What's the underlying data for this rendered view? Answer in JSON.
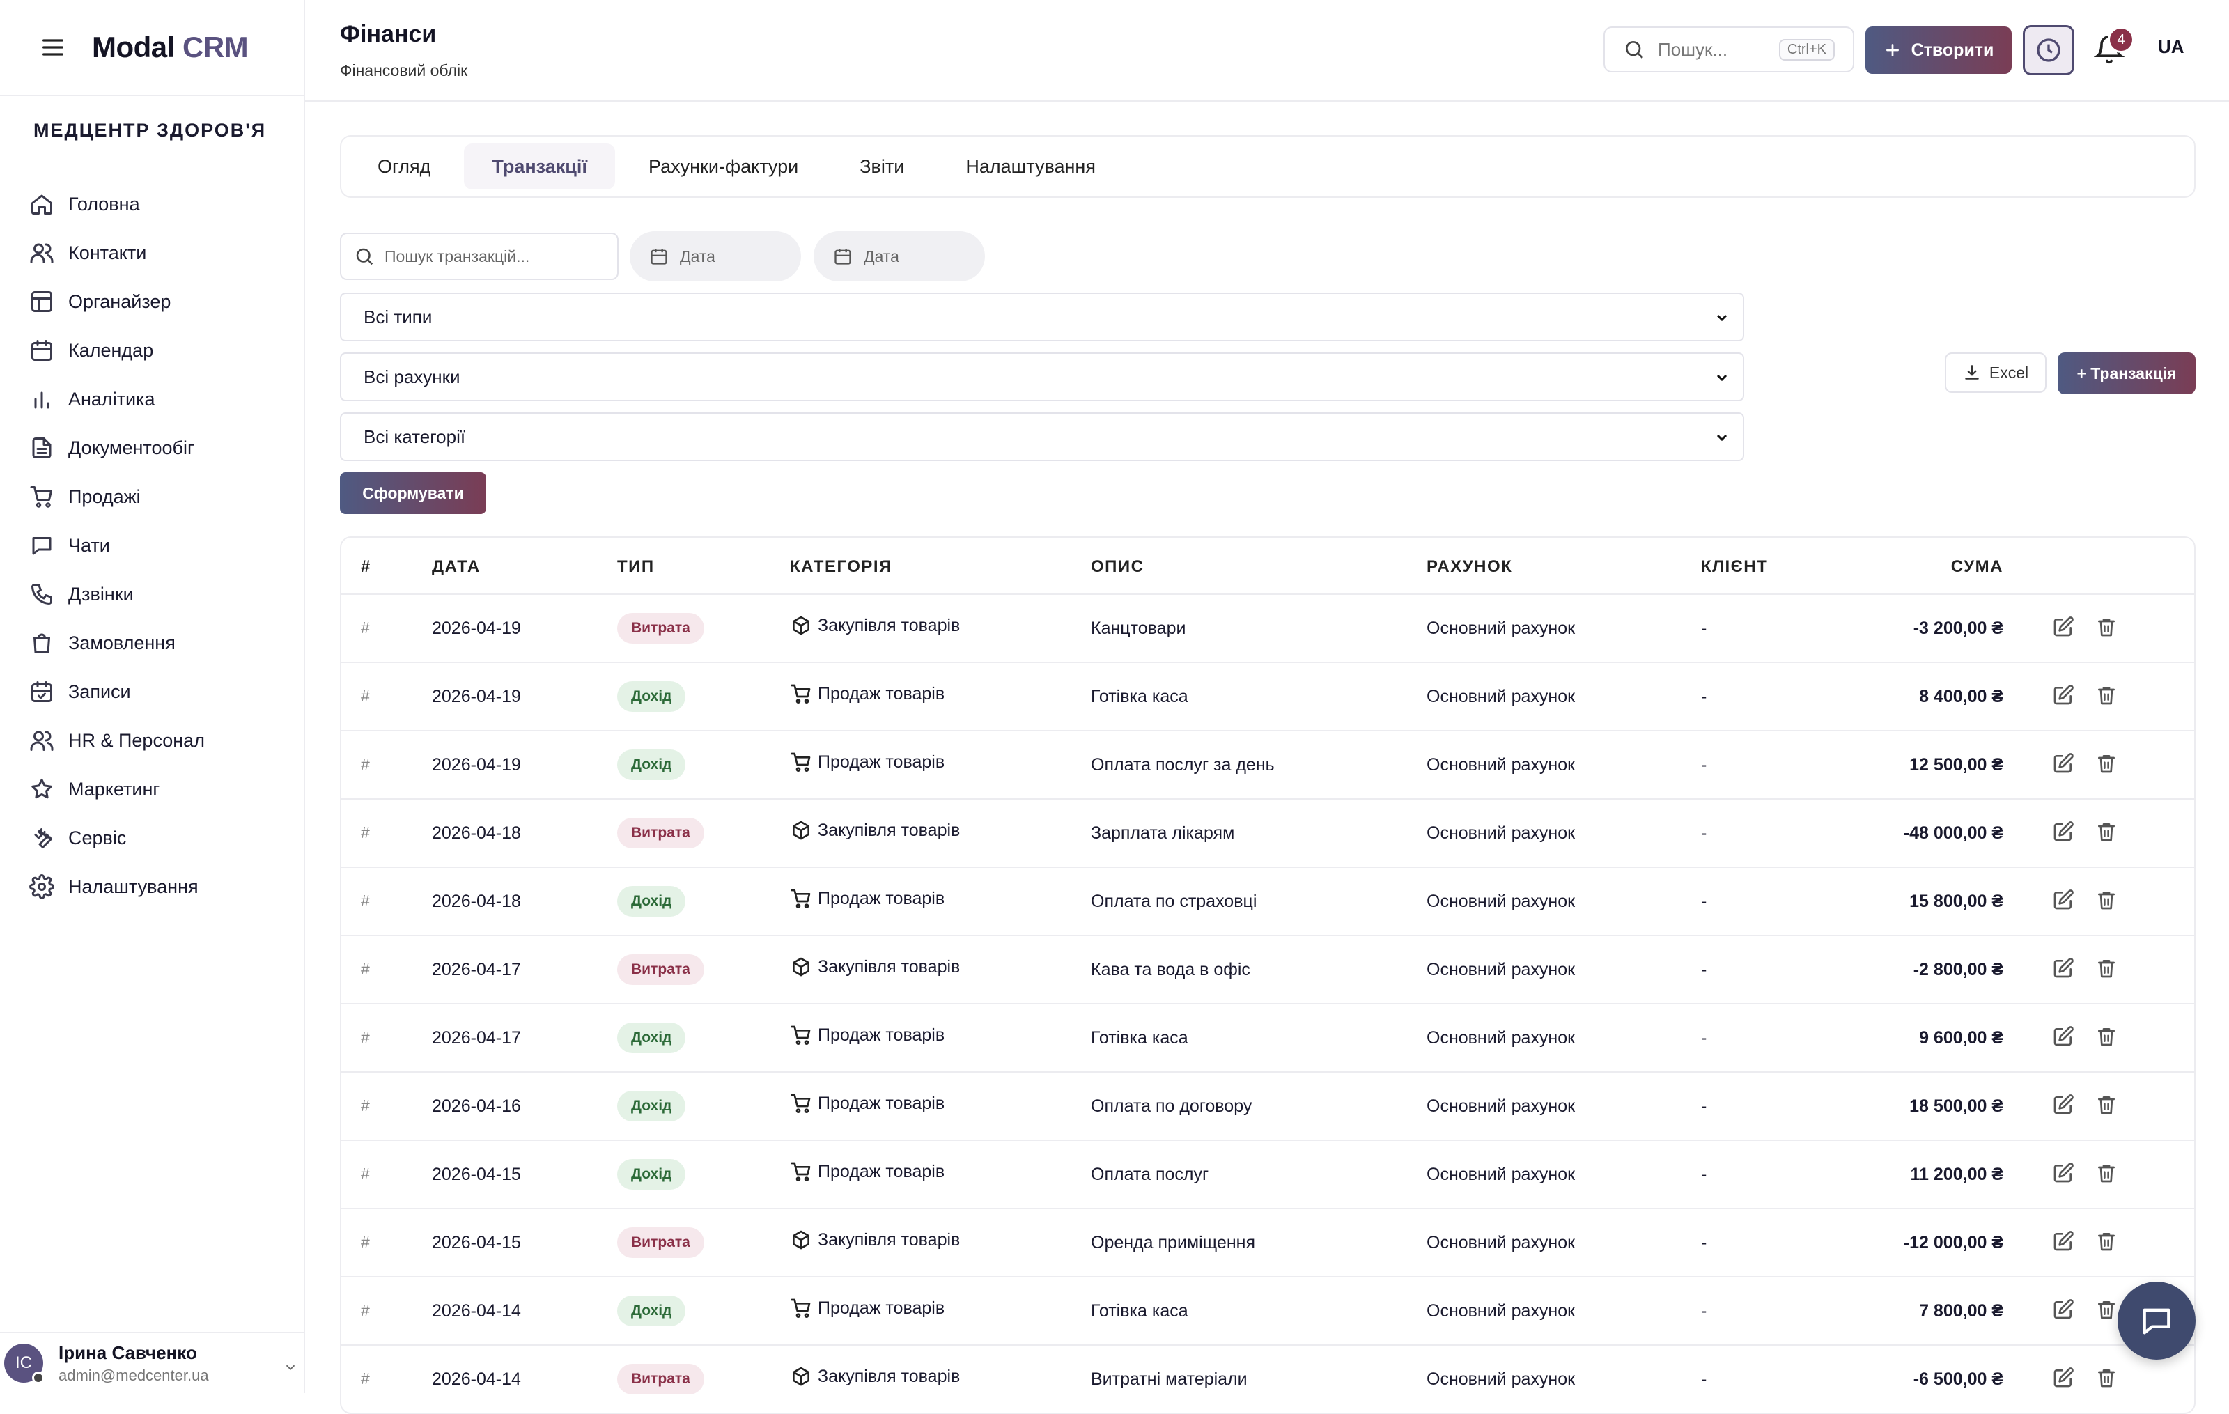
{
  "app": {
    "logo_main": "Modal",
    "logo_accent": "CRM"
  },
  "sidebar": {
    "org_name": "МЕДЦЕНТР ЗДОРОВ'Я",
    "items": [
      {
        "label": "Головна",
        "icon": "home-icon"
      },
      {
        "label": "Контакти",
        "icon": "users-icon"
      },
      {
        "label": "Органайзер",
        "icon": "layout-icon"
      },
      {
        "label": "Календар",
        "icon": "calendar-icon"
      },
      {
        "label": "Аналітика",
        "icon": "bar-chart-icon"
      },
      {
        "label": "Документообіг",
        "icon": "document-icon"
      },
      {
        "label": "Продажі",
        "icon": "cart-icon"
      },
      {
        "label": "Чати",
        "icon": "chat-icon"
      },
      {
        "label": "Дзвінки",
        "icon": "phone-icon"
      },
      {
        "label": "Замовлення",
        "icon": "bag-icon"
      },
      {
        "label": "Записи",
        "icon": "calendar-check-icon"
      },
      {
        "label": "HR & Персонал",
        "icon": "users-icon"
      },
      {
        "label": "Маркетинг",
        "icon": "star-icon"
      },
      {
        "label": "Сервіс",
        "icon": "wrench-icon"
      },
      {
        "label": "Налаштування",
        "icon": "gear-icon"
      }
    ],
    "user": {
      "initials": "IC",
      "name": "Ірина Савченко",
      "email": "admin@medcenter.ua"
    }
  },
  "header": {
    "title": "Фінанси",
    "subtitle": "Фінансовий облік",
    "search_placeholder": "Пошук...",
    "search_shortcut": "Ctrl+K",
    "create_label": "Створити",
    "notifications_count": "4",
    "language": "UA"
  },
  "tabs": [
    {
      "label": "Огляд",
      "active": false
    },
    {
      "label": "Транзакції",
      "active": true
    },
    {
      "label": "Рахунки-фактури",
      "active": false
    },
    {
      "label": "Звіти",
      "active": false
    },
    {
      "label": "Налаштування",
      "active": false
    }
  ],
  "filters": {
    "search_placeholder": "Пошук транзакцій...",
    "date_from_placeholder": "Дата",
    "date_to_placeholder": "Дата",
    "type_selected": "Всі типи",
    "account_selected": "Всі рахунки",
    "category_selected": "Всі категорії",
    "generate_label": "Сформувати",
    "excel_label": "Excel",
    "add_transaction_label": "+ Транзакція"
  },
  "table": {
    "columns": [
      "#",
      "ДАТА",
      "ТИП",
      "КАТЕГОРІЯ",
      "ОПИС",
      "РАХУНОК",
      "КЛІЄНТ",
      "СУМА"
    ],
    "rows": [
      {
        "num": "#",
        "date": "2026-04-19",
        "type": "Витрата",
        "kind": "expense",
        "category": "Закупівля товарів",
        "description": "Канцтовари",
        "account": "Основний рахунок",
        "client": "-",
        "amount": "-3 200,00 ₴"
      },
      {
        "num": "#",
        "date": "2026-04-19",
        "type": "Дохід",
        "kind": "income",
        "category": "Продаж товарів",
        "description": "Готівка каса",
        "account": "Основний рахунок",
        "client": "-",
        "amount": "8 400,00 ₴"
      },
      {
        "num": "#",
        "date": "2026-04-19",
        "type": "Дохід",
        "kind": "income",
        "category": "Продаж товарів",
        "description": "Оплата послуг за день",
        "account": "Основний рахунок",
        "client": "-",
        "amount": "12 500,00 ₴"
      },
      {
        "num": "#",
        "date": "2026-04-18",
        "type": "Витрата",
        "kind": "expense",
        "category": "Закупівля товарів",
        "description": "Зарплата лікарям",
        "account": "Основний рахунок",
        "client": "-",
        "amount": "-48 000,00 ₴"
      },
      {
        "num": "#",
        "date": "2026-04-18",
        "type": "Дохід",
        "kind": "income",
        "category": "Продаж товарів",
        "description": "Оплата по страховці",
        "account": "Основний рахунок",
        "client": "-",
        "amount": "15 800,00 ₴"
      },
      {
        "num": "#",
        "date": "2026-04-17",
        "type": "Витрата",
        "kind": "expense",
        "category": "Закупівля товарів",
        "description": "Кава та вода в офіс",
        "account": "Основний рахунок",
        "client": "-",
        "amount": "-2 800,00 ₴"
      },
      {
        "num": "#",
        "date": "2026-04-17",
        "type": "Дохід",
        "kind": "income",
        "category": "Продаж товарів",
        "description": "Готівка каса",
        "account": "Основний рахунок",
        "client": "-",
        "amount": "9 600,00 ₴"
      },
      {
        "num": "#",
        "date": "2026-04-16",
        "type": "Дохід",
        "kind": "income",
        "category": "Продаж товарів",
        "description": "Оплата по договору",
        "account": "Основний рахунок",
        "client": "-",
        "amount": "18 500,00 ₴"
      },
      {
        "num": "#",
        "date": "2026-04-15",
        "type": "Дохід",
        "kind": "income",
        "category": "Продаж товарів",
        "description": "Оплата послуг",
        "account": "Основний рахунок",
        "client": "-",
        "amount": "11 200,00 ₴"
      },
      {
        "num": "#",
        "date": "2026-04-15",
        "type": "Витрата",
        "kind": "expense",
        "category": "Закупівля товарів",
        "description": "Оренда приміщення",
        "account": "Основний рахунок",
        "client": "-",
        "amount": "-12 000,00 ₴"
      },
      {
        "num": "#",
        "date": "2026-04-14",
        "type": "Дохід",
        "kind": "income",
        "category": "Продаж товарів",
        "description": "Готівка каса",
        "account": "Основний рахунок",
        "client": "-",
        "amount": "7 800,00 ₴"
      },
      {
        "num": "#",
        "date": "2026-04-14",
        "type": "Витрата",
        "kind": "expense",
        "category": "Закупівля товарів",
        "description": "Витратні матеріали",
        "account": "Основний рахунок",
        "client": "-",
        "amount": "-6 500,00 ₴"
      }
    ]
  },
  "colors": {
    "brand": "#5a5280",
    "button_gradient_start": "#4f5a82",
    "button_gradient_end": "#7a3d55",
    "expense_badge_bg": "#f6e8ec",
    "expense_badge_text": "#8a3048",
    "income_badge_bg": "#e4f2e6",
    "income_badge_text": "#2c6a38",
    "notification_badge": "#8a3048"
  }
}
